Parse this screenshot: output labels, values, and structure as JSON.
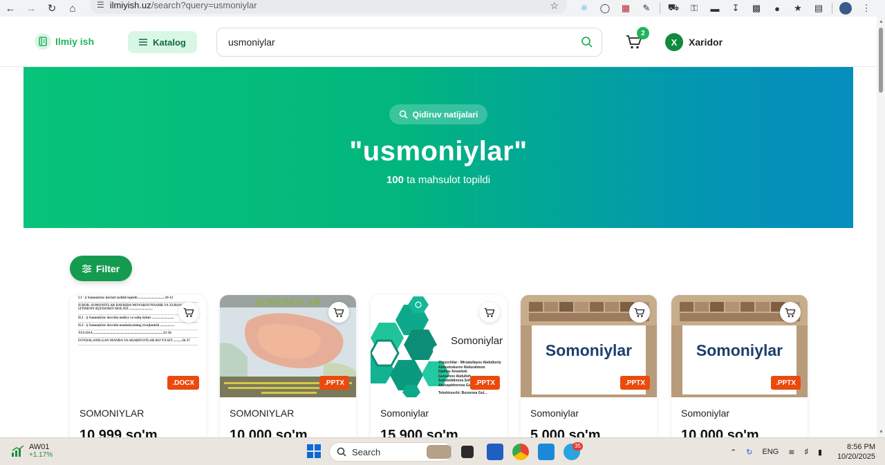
{
  "browser": {
    "url_host": "ilmiyish.uz",
    "url_path": "/search?query=usmoniylar",
    "star_icon": "star-icon"
  },
  "header": {
    "logo_text": "Ilmiy ish",
    "catalog_label": "Katalog",
    "search_value": "usmoniylar",
    "cart_count": "2",
    "user_initial": "X",
    "user_name": "Xaridor"
  },
  "hero": {
    "pill_label": "Qidiruv natijalari",
    "title": "\"usmoniylar\"",
    "result_count": "100",
    "result_text": "ta mahsulot topildi"
  },
  "filter": {
    "label": "Filter"
  },
  "products": [
    {
      "title": "SOMONIYLAR",
      "price": "10 999 so'm",
      "format": ".DOCX",
      "doc_lines": [
        "I.1 - § Somoniylar davlati tashkil topishi ...............................10-12",
        "II BOB. SOMONIYLAR DAVRIDA MOVAROUNNAHR VA XUROSONNING IJTIMOIY-IQTISODIY HOLATI ...........................",
        "II.1 - § Somoniylar davrida moliya va soliq tizimi ..........................",
        "II.2 - § Somoniylar davrida madaniyatning rivojlanishi .................",
        "XULOSA .................................................................................33-36",
        "FOYDALANILGAN MANBA VA ADABIYOTLAR RO'YXATI ..........36-37"
      ]
    },
    {
      "title": "SOMONIYLAR",
      "price": "10 000 so'm",
      "format": ".PPTX",
      "thumb_title": "SOMONIYLAR"
    },
    {
      "title": "Somoniylar",
      "price": "15 900 so'm",
      "format": ".PPTX",
      "thumb_title": "Somoniylar",
      "thumb_lines": [
        "O'quvchilar : Mirzatullayev Abdulboriy",
        "Abdushukurov Abdurahmon",
        "Djalilov Anvarbek",
        "Gulyamov Abdulloh",
        "Sohobiddinova Sofiya",
        "Abduqahhorova Gul...",
        "Tekshiruvchi: Bozorova Gul..."
      ]
    },
    {
      "title": "Somoniylar",
      "price": "5 000 so'm",
      "format": ".PPTX",
      "thumb_title": "Somoniylar"
    },
    {
      "title": "Somoniylar",
      "price": "10 000 so'm",
      "format": ".PPTX",
      "thumb_title": "Somoniylar"
    }
  ],
  "taskbar": {
    "stock_name": "AW01",
    "stock_change": "+1.17%",
    "search_placeholder": "Search",
    "notification_count": "35",
    "language": "ENG",
    "time": "8:56 PM",
    "date": "10/20/2025"
  },
  "colors": {
    "brand_green": "#22b35e",
    "hero_gradient_start": "#07c47a",
    "hero_gradient_end": "#058ebf",
    "badge_orange": "#ea4a0c"
  }
}
